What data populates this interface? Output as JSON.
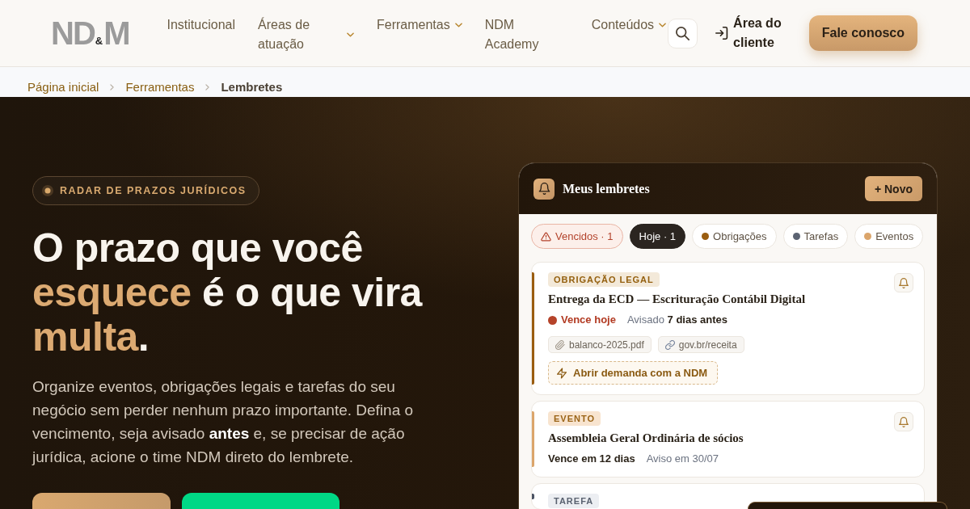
{
  "header": {
    "logo": {
      "left": "ND",
      "amp": "&",
      "right": "M"
    },
    "nav": [
      {
        "label": "Institucional",
        "has_menu": false
      },
      {
        "label": "Áreas de atuação",
        "has_menu": true
      },
      {
        "label": "Ferramentas",
        "has_menu": true
      },
      {
        "label": "NDM Academy",
        "has_menu": false
      },
      {
        "label": "Conteúdos",
        "has_menu": true
      }
    ],
    "client_link": "Área do cliente",
    "cta": "Fale conosco"
  },
  "breadcrumb": [
    {
      "label": "Página inicial",
      "current": false
    },
    {
      "label": "Ferramentas",
      "current": false
    },
    {
      "label": "Lembretes",
      "current": true
    }
  ],
  "hero": {
    "eyebrow": "RADAR DE PRAZOS JURÍDICOS",
    "headline": [
      {
        "text": "O prazo que você ",
        "highlight": false
      },
      {
        "text": "esquece",
        "highlight": true
      },
      {
        "text": " é o que vira ",
        "highlight": false
      },
      {
        "text": "multa",
        "highlight": true
      },
      {
        "text": ".",
        "highlight": false
      }
    ],
    "lead": "Organize eventos, obrigações legais e tarefas do seu negócio sem perder nenhum prazo importante. Defina o vencimento, seja avisado **antes** e, se precisar de ação jurídica, acione o time NDM direto do lembrete.",
    "buttons": [
      {
        "kind": "primary"
      },
      {
        "kind": "secondary"
      }
    ]
  },
  "reminders": {
    "title": "Meus lembretes",
    "new_button": "+ Novo",
    "filters": [
      {
        "kind": "overdue",
        "label": "Vencidos · 1",
        "selected": false
      },
      {
        "kind": "count",
        "label": "Hoje · 1",
        "selected": true
      },
      {
        "kind": "category",
        "label": "Obrigações",
        "color": "#9a5d10",
        "selected": false
      },
      {
        "kind": "category",
        "label": "Tarefas",
        "color": "#5b6372",
        "selected": false
      },
      {
        "kind": "category",
        "label": "Eventos",
        "color": "#dba56b",
        "selected": false
      }
    ],
    "items": [
      {
        "kind": "obligation",
        "color": "#9a5d10",
        "tag": "OBRIGAÇÃO LEGAL",
        "title": "Entrega da ECD — Escrituração Contábil Digital",
        "due": "Vence hoje",
        "due_today": true,
        "notice": "Avisado **7 dias antes**",
        "attachments": [
          {
            "kind": "file",
            "label": "balanco-2025.pdf"
          },
          {
            "kind": "link",
            "label": "gov.br/receita"
          }
        ],
        "action": "Abrir demanda com a NDM"
      },
      {
        "kind": "event",
        "color": "#dba56b",
        "tag": "EVENTO",
        "title": "Assembleia Geral Ordinária de sócios",
        "due": "Vence em 12 dias",
        "due_today": false,
        "notice": "Aviso em 30/07"
      },
      {
        "kind": "task",
        "color": "#4a5262",
        "tag": "TAREFA"
      }
    ]
  }
}
